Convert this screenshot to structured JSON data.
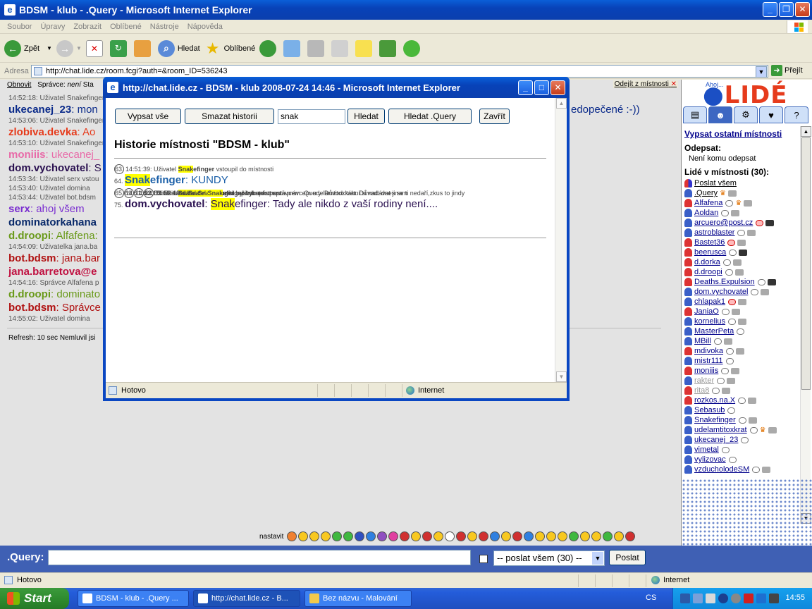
{
  "window": {
    "title": "BDSM - klub - .Query - Microsoft Internet Explorer",
    "menu": [
      "Soubor",
      "Úpravy",
      "Zobrazit",
      "Oblíbené",
      "Nástroje",
      "Nápověda"
    ],
    "toolbar": {
      "back": "Zpět",
      "search": "Hledat",
      "favorites": "Oblíbené"
    },
    "address_label": "Adresa",
    "address_url": "http://chat.lide.cz/room.fcgi?auth=&room_ID=536243",
    "go_label": "Přejít",
    "status_left": "Hotovo",
    "status_zone": "Internet"
  },
  "chat": {
    "top_links": [
      "Obnovit",
      "Správce:"
    ],
    "admin_value": "není",
    "top_cut": "Sta",
    "leave_label": "Odejít z místnosti",
    "messages": [
      {
        "type": "sys",
        "text": "14:52:18: Uživatel Snakefinger",
        "color": "#555555"
      },
      {
        "type": "big",
        "nick": "ukecanej_23",
        "text": ": mon",
        "color": "#0a2a8a"
      },
      {
        "type": "sys",
        "text": "14:53:06: Uživatel Snakefinger",
        "color": "#555555"
      },
      {
        "type": "big",
        "nick": "zlobiva.devka",
        "text": ": Ao",
        "color": "#e63b1c"
      },
      {
        "type": "sys",
        "text": "14:53:10: Uživatel Snakefinger",
        "color": "#555555"
      },
      {
        "type": "big",
        "nick": "moniiis",
        "text": ": ukecanej_",
        "color": "#e86aa8"
      },
      {
        "type": "big",
        "nick": "dom.vychovatel",
        "text": ": S",
        "color": "#2a1050"
      },
      {
        "type": "sys",
        "text": "14:53:34: Uživatel serx vstou",
        "color": "#555555"
      },
      {
        "type": "sys",
        "text": "14:53:40: Uživatel domina",
        "color": "#555555"
      },
      {
        "type": "sys",
        "text": "14:53:44: Uživatel bot.bdsm",
        "color": "#555555"
      },
      {
        "type": "big",
        "nick": "serx",
        "text": ": ahoj všem",
        "color": "#7a2ed0"
      },
      {
        "type": "big",
        "nick": "dominatorkahana",
        "text": "",
        "color": "#0a2a6a"
      },
      {
        "type": "big",
        "nick": "d.droopi",
        "text": ": Alfafena:",
        "color": "#6a9a1a"
      },
      {
        "type": "sys",
        "text": "14:54:09: Uživatelka jana.ba",
        "color": "#555555"
      },
      {
        "type": "big",
        "nick": "bot.bdsm",
        "text": ": jana.bar",
        "color": "#b01010"
      },
      {
        "type": "big",
        "nick": "jana.barretova@e",
        "text": "",
        "color": "#c01040"
      },
      {
        "type": "sys",
        "text": "14:54:16: Správce Alfafena p",
        "color": "#555555"
      },
      {
        "type": "big",
        "nick": "d.droopi",
        "text": ": dominato",
        "color": "#6a9a1a"
      },
      {
        "type": "big",
        "nick": "bot.bdsm",
        "text": ": Správce",
        "color": "#b01010"
      },
      {
        "type": "sys",
        "text": "14:55:02: Uživatel domina",
        "color": "#555555"
      }
    ],
    "tail_text": "edopečené :-))",
    "refresh_text": "Refresh: 10 sec    Nemluvil jsi",
    "smiley_label": "nastavit"
  },
  "sidebar": {
    "logo_text": "LIDÉ",
    "logo_small": "Ahoj...",
    "other_rooms_link": "Vypsat ostatní místnosti",
    "send_to_label": "Odepsat:",
    "send_to_value": "Není komu odepsat",
    "people_label": "Lidé v místnosti (30):",
    "send_all": "Poslat všem",
    "users": [
      {
        "name": ".Query",
        "style": "plain",
        "gender": "m",
        "crown": true,
        "bubble": false,
        "cam": "light"
      },
      {
        "name": "Alfafena",
        "style": "link",
        "gender": "f",
        "crown": true,
        "bubble": true,
        "cam": "light"
      },
      {
        "name": "Aoldan",
        "style": "link",
        "gender": "m",
        "crown": false,
        "bubble": true,
        "cam": "light"
      },
      {
        "name": "arcuero@post.cz",
        "style": "link",
        "gender": "m",
        "crown": false,
        "bubble": "red",
        "cam": "dark"
      },
      {
        "name": "astroblaster",
        "style": "link",
        "gender": "m",
        "crown": false,
        "bubble": true,
        "cam": "light"
      },
      {
        "name": "Bastet36",
        "style": "link",
        "gender": "f",
        "crown": false,
        "bubble": "red",
        "cam": "light"
      },
      {
        "name": "beerusca",
        "style": "link",
        "gender": "f",
        "crown": false,
        "bubble": true,
        "cam": "dark"
      },
      {
        "name": "d.dorka",
        "style": "link",
        "gender": "f",
        "crown": false,
        "bubble": true,
        "cam": "light"
      },
      {
        "name": "d.droopi",
        "style": "link",
        "gender": "f",
        "crown": false,
        "bubble": true,
        "cam": "light"
      },
      {
        "name": "Deaths.Expulsion",
        "style": "link",
        "gender": "f",
        "crown": false,
        "bubble": true,
        "cam": "dark"
      },
      {
        "name": "dom.vychovatel",
        "style": "link",
        "gender": "m",
        "crown": false,
        "bubble": true,
        "cam": "light"
      },
      {
        "name": "chlapak1",
        "style": "link",
        "gender": "m",
        "crown": false,
        "bubble": "red",
        "cam": "light"
      },
      {
        "name": "JaniaO",
        "style": "link",
        "gender": "f",
        "crown": false,
        "bubble": true,
        "cam": "light"
      },
      {
        "name": "kornelius",
        "style": "link",
        "gender": "m",
        "crown": false,
        "bubble": true,
        "cam": "light"
      },
      {
        "name": "MasterPeta",
        "style": "link",
        "gender": "m",
        "crown": false,
        "bubble": true,
        "cam": "none"
      },
      {
        "name": "MBill",
        "style": "link",
        "gender": "m",
        "crown": false,
        "bubble": true,
        "cam": "light"
      },
      {
        "name": "mdivoka",
        "style": "link",
        "gender": "f",
        "crown": false,
        "bubble": true,
        "cam": "light"
      },
      {
        "name": "mistr111",
        "style": "link",
        "gender": "m",
        "crown": false,
        "bubble": true,
        "cam": "none"
      },
      {
        "name": "moniiis",
        "style": "link",
        "gender": "f",
        "crown": false,
        "bubble": true,
        "cam": "light"
      },
      {
        "name": "rakter",
        "style": "grey",
        "gender": "m",
        "crown": false,
        "bubble": true,
        "cam": "light"
      },
      {
        "name": "rita8",
        "style": "grey",
        "gender": "f",
        "crown": false,
        "bubble": true,
        "cam": "light"
      },
      {
        "name": "rozkos.na.X",
        "style": "link",
        "gender": "f",
        "crown": false,
        "bubble": true,
        "cam": "light"
      },
      {
        "name": "Sebasub",
        "style": "link",
        "gender": "m",
        "crown": false,
        "bubble": true,
        "cam": "none"
      },
      {
        "name": "Snakefinger",
        "style": "link",
        "gender": "m",
        "crown": false,
        "bubble": true,
        "cam": "light"
      },
      {
        "name": "udelamtitoxkrat",
        "style": "link",
        "gender": "m",
        "crown": true,
        "bubble": true,
        "cam": "light"
      },
      {
        "name": "ukecanej_23",
        "style": "link",
        "gender": "m",
        "crown": false,
        "bubble": true,
        "cam": "none"
      },
      {
        "name": "vimetal",
        "style": "link",
        "gender": "m",
        "crown": false,
        "bubble": true,
        "cam": "none"
      },
      {
        "name": "vylizovac",
        "style": "link",
        "gender": "m",
        "crown": false,
        "bubble": true,
        "cam": "none"
      },
      {
        "name": "vzducholodeSM",
        "style": "link",
        "gender": "m",
        "crown": false,
        "bubble": true,
        "cam": "light"
      }
    ]
  },
  "input": {
    "nick": ".Query:",
    "target_select": "-- poslat všem (30) --",
    "send_label": "Poslat"
  },
  "popup": {
    "title": "http://chat.lide.cz - BDSM - klub 2008-07-24 14:46 - Microsoft Internet Explorer",
    "buttons": {
      "list_all": "Vypsat vše",
      "clear": "Smazat historii",
      "find": "Hledat",
      "find_query": "Hledat .Query",
      "close": "Zavřít"
    },
    "search_value": "snak",
    "heading": "Historie místnosti \"BDSM - klub\"",
    "status_left": "Hotovo",
    "status_zone": "Internet",
    "lines": [
      {
        "size": "sm",
        "pre": "63. 14:51:39: Uživatel ",
        "hi": "Snak",
        "nick_rest": "efinger",
        "post": " vstoupil do místnosti",
        "color": "#444444"
      },
      {
        "size": "lg",
        "pre": "64. ",
        "hi": "Snak",
        "nick_rest": "efinger",
        "post": ": KUNDY",
        "color": "#1a5fa8"
      },
      {
        "size": "sm",
        "pre": "65. 14:51:44: Uživatel ",
        "hi": "Snak",
        "nick_rest": "efinger",
        "post": " opustil místnost",
        "color": "#444444"
      },
      {
        "size": "sm",
        "pre": "69. 14:52:18: Uživatel ",
        "hi": "Snak",
        "nick_rest": "efinger",
        "post": " vstoupil do místnosti",
        "color": "#444444"
      },
      {
        "size": "sm",
        "pre": "71. 14:53:06: Uživatel ",
        "hi": "Snak",
        "nick_rest": "efinger",
        "post": " byl vykopnut správcem .Query. Důvod: táhni si nadávat jinam",
        "color": "#444444"
      },
      {
        "size": "sm",
        "pre": "73. 14:53:10: Uživatel ",
        "hi": "Snak",
        "nick_rest": "efinger",
        "post": " byl nakopnut správcem udelamtitoxkrat. Důvod: dnes se ti nedaří,zkus to jindy",
        "color": "#444444"
      },
      {
        "size": "lg",
        "pre": "75. ",
        "nick": "dom.vychovatel",
        "hi": "Snak",
        "nick_rest": "efinger",
        "post": ": Tady ale nikdo z vaší rodiny není....",
        "color": "#2a1050"
      }
    ]
  },
  "taskbar": {
    "start": "Start",
    "tasks": [
      "BDSM - klub - .Query ...",
      "http://chat.lide.cz - B...",
      "Bez názvu - Malování"
    ],
    "lang": "CS",
    "clock": "14:55"
  }
}
